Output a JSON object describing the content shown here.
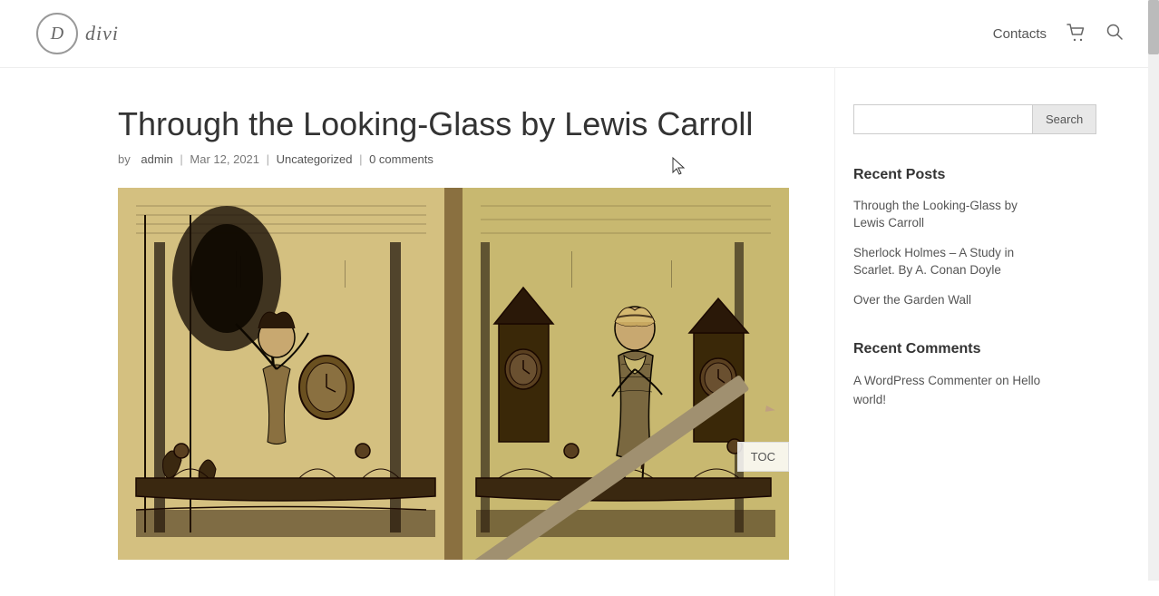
{
  "site": {
    "logo_letter": "D",
    "logo_name": "divi"
  },
  "nav": {
    "contacts_label": "Contacts",
    "cart_icon": "🛒",
    "search_icon": "🔍"
  },
  "post": {
    "title": "Through the Looking-Glass by Lewis Carroll",
    "meta": {
      "by_label": "by",
      "author": "admin",
      "date": "Mar 12, 2021",
      "category": "Uncategorized",
      "comments": "0 comments"
    },
    "toc_label": "TOC"
  },
  "sidebar": {
    "search": {
      "placeholder": "",
      "button_label": "Search"
    },
    "recent_posts": {
      "title": "Recent Posts",
      "items": [
        {
          "label": "Through the Looking-Glass by Lewis Carroll"
        },
        {
          "label": "Sherlock Holmes – A Study in Scarlet. By A. Conan Doyle"
        },
        {
          "label": "Over the Garden Wall"
        }
      ]
    },
    "recent_comments": {
      "title": "Recent Comments",
      "items": [
        {
          "author": "A WordPress Commenter",
          "connector": "on",
          "post": "Hello world!"
        }
      ]
    }
  }
}
